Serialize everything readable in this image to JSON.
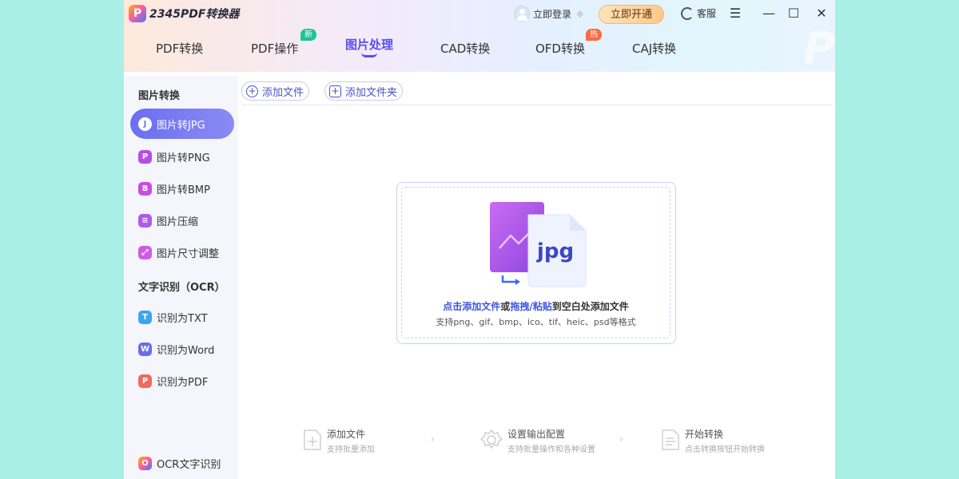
{
  "app": {
    "title": "2345PDF转换器",
    "logo_letter": "P"
  },
  "header": {
    "login_label": "立即登录",
    "vip_button": "立即开通",
    "service_label": "客服",
    "menu_glyph": "☰",
    "minimize_glyph": "—",
    "maximize_glyph": "☐",
    "close_glyph": "✕"
  },
  "tabs": [
    {
      "label": "PDF转换"
    },
    {
      "label": "PDF操作",
      "badge": "新"
    },
    {
      "label": "图片处理",
      "active": true
    },
    {
      "label": "CAD转换"
    },
    {
      "label": "OFD转换",
      "badge": "热"
    },
    {
      "label": "CAJ转换"
    }
  ],
  "sidebar": {
    "section1": "图片转换",
    "items1": [
      {
        "label": "图片转JPG",
        "icon": "J",
        "active": true
      },
      {
        "label": "图片转PNG",
        "icon": "P"
      },
      {
        "label": "图片转BMP",
        "icon": "B"
      },
      {
        "label": "图片压缩",
        "icon": "≡"
      },
      {
        "label": "图片尺寸调整",
        "icon": "⤢"
      }
    ],
    "section2": "文字识别（OCR）",
    "items2": [
      {
        "label": "识别为TXT",
        "icon": "T"
      },
      {
        "label": "识别为Word",
        "icon": "W"
      },
      {
        "label": "识别为PDF",
        "icon": "P"
      }
    ],
    "bottom_item": "OCR文字识别"
  },
  "toolbar": {
    "add_file": "添加文件",
    "add_folder": "添加文件夹"
  },
  "dropzone": {
    "file_ext": "jpg",
    "main_1": "点击添加文件",
    "main_2": "或",
    "main_3": "拖拽/粘贴",
    "main_4": "到空白处添加文件",
    "sub": "支持png、gif、bmp、ico、tif、heic、psd等格式"
  },
  "steps": [
    {
      "title": "添加文件",
      "sub": "支持批量添加"
    },
    {
      "title": "设置输出配置",
      "sub": "支持批量操作和各种设置"
    },
    {
      "title": "开始转换",
      "sub": "点击转换按钮开始转换"
    }
  ],
  "colors": {
    "accent": "#5b4ef0",
    "link": "#3d55e6",
    "page_bg": "#a9efe6",
    "sidebar_bg": "#f4f6fc"
  }
}
